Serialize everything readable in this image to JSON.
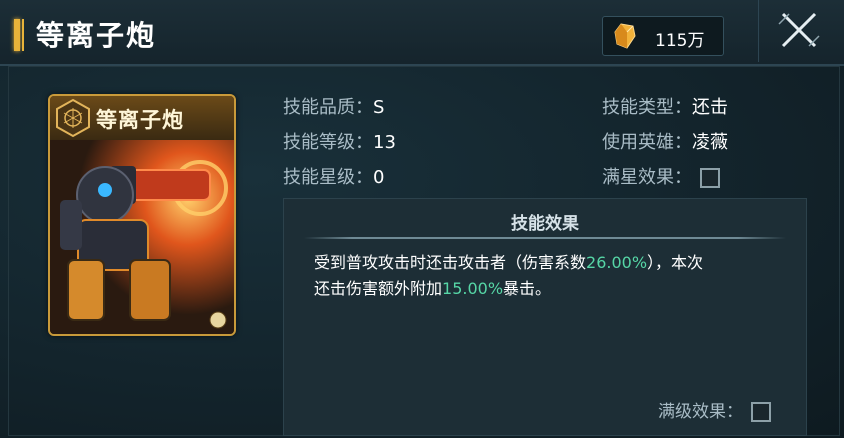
{
  "header": {
    "title": "等离子炮",
    "currency_icon": "crystal-gem-icon",
    "currency_amount": "115万",
    "close_icon": "close-icon"
  },
  "card": {
    "emblem_icon": "hexagon-emblem-icon",
    "title": "等离子炮"
  },
  "stats": {
    "quality_label": "技能品质：",
    "quality_value": "S",
    "level_label": "技能等级：",
    "level_value": "13",
    "star_label": "技能星级：",
    "star_value": "0",
    "type_label": "技能类型：",
    "type_value": "还击",
    "hero_label": "使用英雄：",
    "hero_value": "凌薇",
    "full_star_label": "满星效果："
  },
  "effect": {
    "title": "技能效果",
    "line1_a": "受到普攻攻击时还击攻击者（伤害系数",
    "line1_pct": "26.00%",
    "line1_b": "），本次",
    "line2_a": "还击伤害额外附加",
    "line2_pct": "15.00%",
    "line2_b": "暴击。",
    "full_level_label": "满级效果："
  },
  "colors": {
    "accent_gold": "#e8b33a",
    "highlight_green": "#56d6a6"
  }
}
